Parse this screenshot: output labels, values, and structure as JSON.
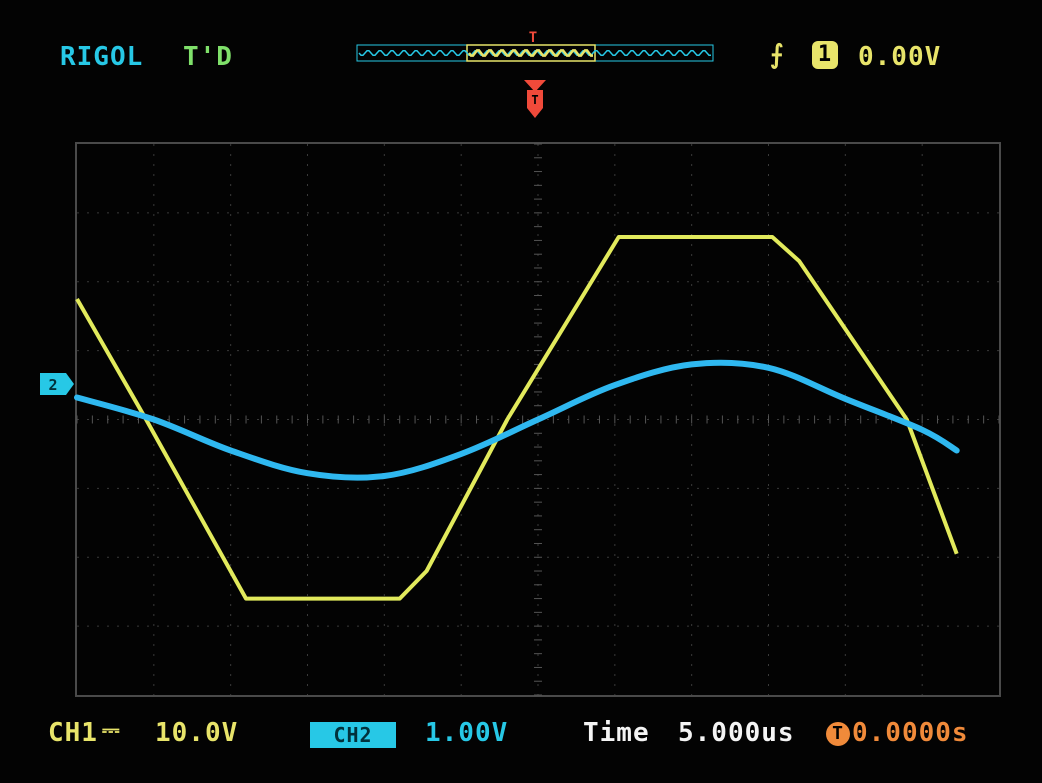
{
  "top_bar": {
    "brand": "RIGOL",
    "status": "T'D",
    "trigger_indicator": "T",
    "trigger_slope_icon": "rising-edge-icon",
    "trigger_source": "1",
    "trigger_level": "0.00V"
  },
  "bottom_bar": {
    "ch1_label": "CH1",
    "ch1_coupling": "⎓",
    "ch1_scale": "10.0V",
    "ch2_badge": "CH2",
    "ch2_scale": "1.00V",
    "time_label": "Time",
    "time_scale": "5.000us",
    "trigger_pos_icon": "T",
    "trigger_position": "0.0000s"
  },
  "markers": {
    "ch2_ground": "2"
  },
  "colors": {
    "ch1": "#e8e46a",
    "ch2": "#27c8e6",
    "grid": "#3a3a3a",
    "trigger": "#f04a3a",
    "time": "#f4f4f4",
    "trigger_pos": "#f08a3a"
  },
  "chart_data": {
    "type": "line",
    "title": "",
    "xlabel": "",
    "ylabel": "",
    "grid": true,
    "x_divisions": 12,
    "y_divisions": 8,
    "series": [
      {
        "name": "CH1",
        "x": [
          0,
          0.9,
          2.2,
          4.2,
          4.55,
          5.6,
          7.05,
          9.05,
          9.4,
          10.8,
          11.45
        ],
        "y": [
          1.75,
          0,
          -2.6,
          -2.6,
          -2.2,
          0,
          2.65,
          2.65,
          2.3,
          0,
          -1.95
        ]
      },
      {
        "name": "CH2",
        "x": [
          0,
          1,
          2,
          3,
          4,
          5,
          6,
          7,
          8,
          9,
          10,
          11,
          11.45
        ],
        "y": [
          0.32,
          0,
          -0.45,
          -0.78,
          -0.82,
          -0.5,
          0,
          0.5,
          0.8,
          0.75,
          0.3,
          -0.15,
          -0.45
        ]
      }
    ]
  }
}
